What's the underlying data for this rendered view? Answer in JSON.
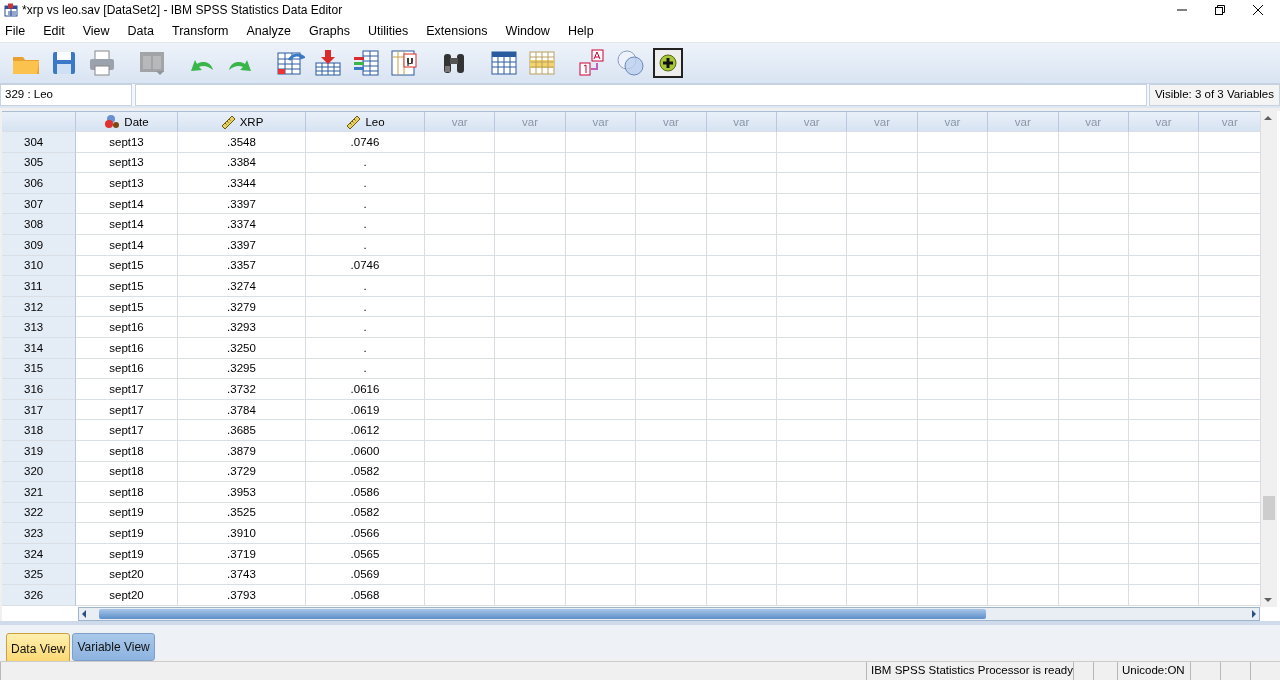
{
  "window": {
    "title": "*xrp vs leo.sav [DataSet2] - IBM SPSS Statistics Data Editor"
  },
  "menu": [
    "File",
    "Edit",
    "View",
    "Data",
    "Transform",
    "Analyze",
    "Graphs",
    "Utilities",
    "Extensions",
    "Window",
    "Help"
  ],
  "toolbar": [
    {
      "disabled": false
    },
    {
      "disabled": false
    },
    {
      "disabled": false
    },
    {
      "disabled": true
    },
    {
      "disabled": false
    },
    {
      "disabled": false
    },
    {
      "disabled": false
    },
    {
      "disabled": false
    },
    {
      "disabled": false
    },
    {
      "disabled": false
    },
    {
      "disabled": false
    },
    {
      "disabled": false
    },
    {
      "disabled": false
    },
    {
      "disabled": false
    },
    {
      "disabled": false
    },
    {
      "disabled": false
    }
  ],
  "cell_editor": {
    "position": "329 : Leo",
    "visible": "Visible: 3 of 3 Variables"
  },
  "columns": [
    {
      "label": "Date",
      "kind": "nominal"
    },
    {
      "label": "XRP",
      "kind": "scale"
    },
    {
      "label": "Leo",
      "kind": "scale"
    },
    {
      "label": "var",
      "kind": "empty"
    },
    {
      "label": "var",
      "kind": "empty"
    },
    {
      "label": "var",
      "kind": "empty"
    },
    {
      "label": "var",
      "kind": "empty"
    },
    {
      "label": "var",
      "kind": "empty"
    },
    {
      "label": "var",
      "kind": "empty"
    },
    {
      "label": "var",
      "kind": "empty"
    },
    {
      "label": "var",
      "kind": "empty"
    },
    {
      "label": "var",
      "kind": "empty"
    },
    {
      "label": "var",
      "kind": "empty"
    },
    {
      "label": "var",
      "kind": "empty"
    },
    {
      "label": "var",
      "kind": "empty"
    }
  ],
  "rows": [
    {
      "case": "304",
      "cells": [
        "sept13",
        ".3548",
        ".0746"
      ]
    },
    {
      "case": "305",
      "cells": [
        "sept13",
        ".3384",
        "."
      ]
    },
    {
      "case": "306",
      "cells": [
        "sept13",
        ".3344",
        "."
      ]
    },
    {
      "case": "307",
      "cells": [
        "sept14",
        ".3397",
        "."
      ]
    },
    {
      "case": "308",
      "cells": [
        "sept14",
        ".3374",
        "."
      ]
    },
    {
      "case": "309",
      "cells": [
        "sept14",
        ".3397",
        "."
      ]
    },
    {
      "case": "310",
      "cells": [
        "sept15",
        ".3357",
        ".0746"
      ]
    },
    {
      "case": "311",
      "cells": [
        "sept15",
        ".3274",
        "."
      ]
    },
    {
      "case": "312",
      "cells": [
        "sept15",
        ".3279",
        "."
      ]
    },
    {
      "case": "313",
      "cells": [
        "sept16",
        ".3293",
        "."
      ]
    },
    {
      "case": "314",
      "cells": [
        "sept16",
        ".3250",
        "."
      ]
    },
    {
      "case": "315",
      "cells": [
        "sept16",
        ".3295",
        "."
      ]
    },
    {
      "case": "316",
      "cells": [
        "sept17",
        ".3732",
        ".0616"
      ]
    },
    {
      "case": "317",
      "cells": [
        "sept17",
        ".3784",
        ".0619"
      ]
    },
    {
      "case": "318",
      "cells": [
        "sept17",
        ".3685",
        ".0612"
      ]
    },
    {
      "case": "319",
      "cells": [
        "sept18",
        ".3879",
        ".0600"
      ]
    },
    {
      "case": "320",
      "cells": [
        "sept18",
        ".3729",
        ".0582"
      ]
    },
    {
      "case": "321",
      "cells": [
        "sept18",
        ".3953",
        ".0586"
      ]
    },
    {
      "case": "322",
      "cells": [
        "sept19",
        ".3525",
        ".0582"
      ]
    },
    {
      "case": "323",
      "cells": [
        "sept19",
        ".3910",
        ".0566"
      ]
    },
    {
      "case": "324",
      "cells": [
        "sept19",
        ".3719",
        ".0565"
      ]
    },
    {
      "case": "325",
      "cells": [
        "sept20",
        ".3743",
        ".0569"
      ]
    },
    {
      "case": "326",
      "cells": [
        "sept20",
        ".3793",
        ".0568"
      ]
    }
  ],
  "tabs": [
    {
      "label": "Data View",
      "selected": true
    },
    {
      "label": "Variable View",
      "selected": false
    }
  ],
  "status_bar": {
    "processor": "IBM SPSS Statistics Processor is ready",
    "encoding": "Unicode:ON"
  }
}
